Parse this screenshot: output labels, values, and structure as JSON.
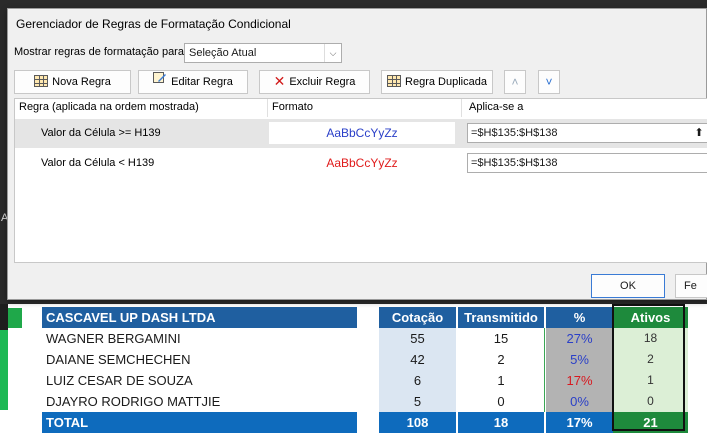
{
  "dialog": {
    "title": "Gerenciador de Regras de Formatação Condicional",
    "show_rules_label": "Mostrar regras de formatação para:",
    "show_rules_value": "Seleção Atual",
    "buttons": {
      "new_rule": "Nova Regra",
      "edit_rule": "Editar Regra",
      "delete_rule": "Excluir Regra",
      "duplicate_rule": "Regra Duplicada"
    },
    "columns": {
      "rule": "Regra (aplicada na ordem mostrada)",
      "format": "Formato",
      "applies_to": "Aplica-se a"
    },
    "rules": [
      {
        "name": "Valor da Célula >= H139",
        "preview": "AaBbCcYyZz",
        "preview_color": "#2a3fc8",
        "applies_to": "=$H$135:$H$138"
      },
      {
        "name": "Valor da Célula < H139",
        "preview": "AaBbCcYyZz",
        "preview_color": "#e01b1b",
        "applies_to": "=$H$135:$H$138"
      }
    ],
    "ok_label": "OK",
    "close_label": "Fe"
  },
  "sheet": {
    "side_letter": "A",
    "header": {
      "company": "CASCAVEL UP DASH LTDA",
      "cotacao": "Cotação",
      "transmitido": "Transmitido",
      "pct": "%",
      "ativos": "Ativos"
    },
    "rows": [
      {
        "name": "WAGNER BERGAMINI",
        "cotacao": "55",
        "transmitido": "15",
        "pct": "27%",
        "pct_status": "above",
        "ativos": "18"
      },
      {
        "name": "DAIANE SEMCHECHEN",
        "cotacao": "42",
        "transmitido": "2",
        "pct": "5%",
        "pct_status": "above",
        "ativos": "2"
      },
      {
        "name": "LUIZ CESAR DE SOUZA",
        "cotacao": "6",
        "transmitido": "1",
        "pct": "17%",
        "pct_status": "below",
        "ativos": "1"
      },
      {
        "name": "DJAYRO RODRIGO MATTJIE",
        "cotacao": "5",
        "transmitido": "0",
        "pct": "0%",
        "pct_status": "above",
        "ativos": "0"
      }
    ],
    "total": {
      "label": "TOTAL",
      "cotacao": "108",
      "transmitido": "18",
      "pct": "17%",
      "ativos": "21"
    }
  },
  "icons": {
    "new_rule": "grid-icon",
    "edit_rule": "edit-icon",
    "delete_rule": "delete-x-icon",
    "duplicate_rule": "grid-icon",
    "move_up": "chevron-up-icon",
    "move_down": "chevron-down-icon",
    "collapse": "collapse-dialog-icon"
  },
  "colors": {
    "header_blue": "#1f5fa0",
    "total_blue": "#0e6bbd",
    "ativos_green": "#1e8a3c",
    "pct_above": "#2a3fc8",
    "pct_below": "#d8181f"
  }
}
